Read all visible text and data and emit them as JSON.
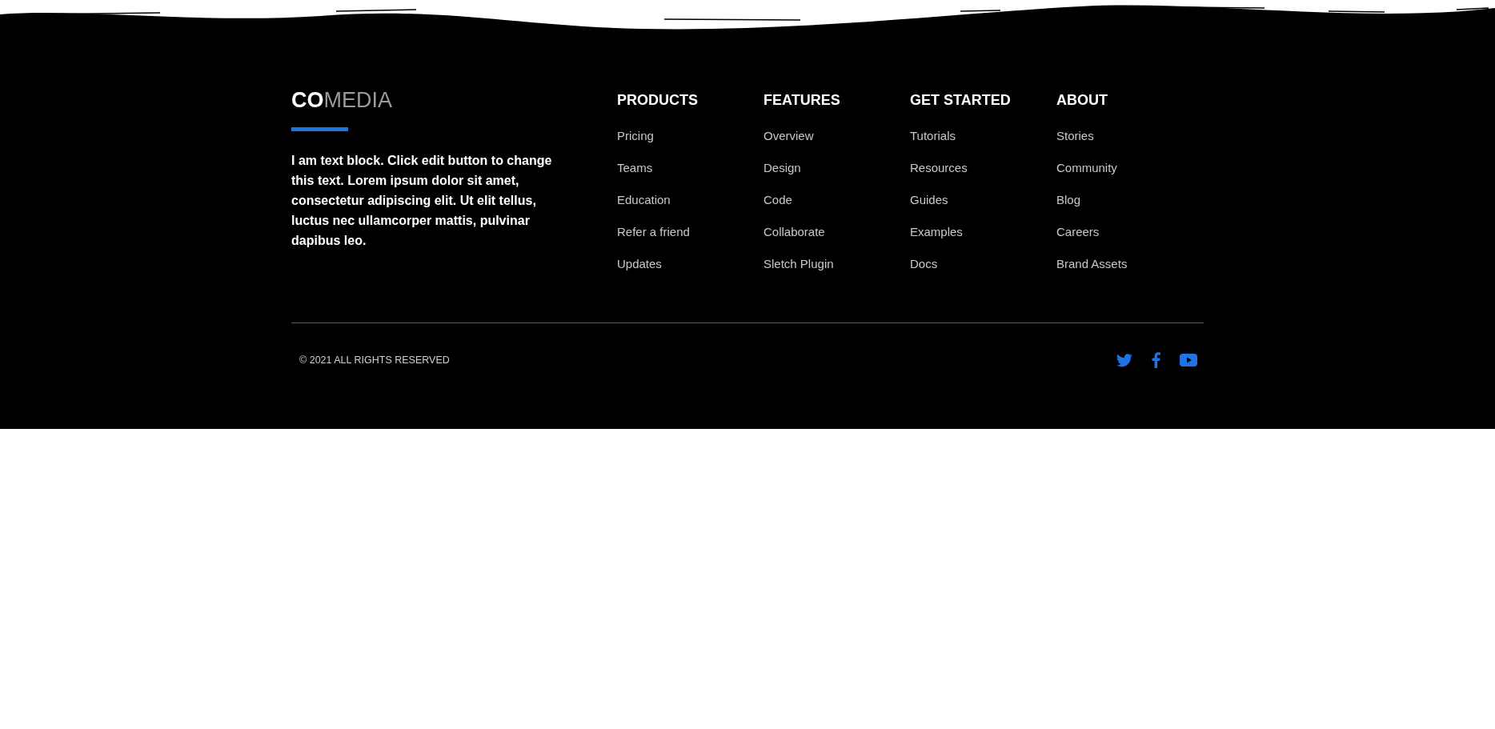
{
  "logo": {
    "bold": "CO",
    "light": "MEDIA"
  },
  "about_text": "I am text block. Click edit button to change this text. Lorem ipsum dolor sit amet, consectetur adipiscing elit. Ut elit tellus, luctus nec ullamcorper mattis, pulvinar dapibus leo.",
  "columns": [
    {
      "heading": "PRODUCTS",
      "links": [
        "Pricing",
        "Teams",
        "Education",
        "Refer a friend",
        "Updates"
      ]
    },
    {
      "heading": "FEATURES",
      "links": [
        "Overview",
        "Design",
        "Code",
        "Collaborate",
        "Sletch Plugin"
      ]
    },
    {
      "heading": "GET STARTED",
      "links": [
        "Tutorials",
        "Resources",
        "Guides",
        "Examples",
        "Docs"
      ]
    },
    {
      "heading": "ABOUT",
      "links": [
        "Stories",
        "Community",
        "Blog",
        "Careers",
        "Brand Assets"
      ]
    }
  ],
  "copyright": "© 2021 ALL RIGHTS RESERVED",
  "social": [
    {
      "kind": "twitter"
    },
    {
      "kind": "facebook"
    },
    {
      "kind": "youtube"
    }
  ]
}
